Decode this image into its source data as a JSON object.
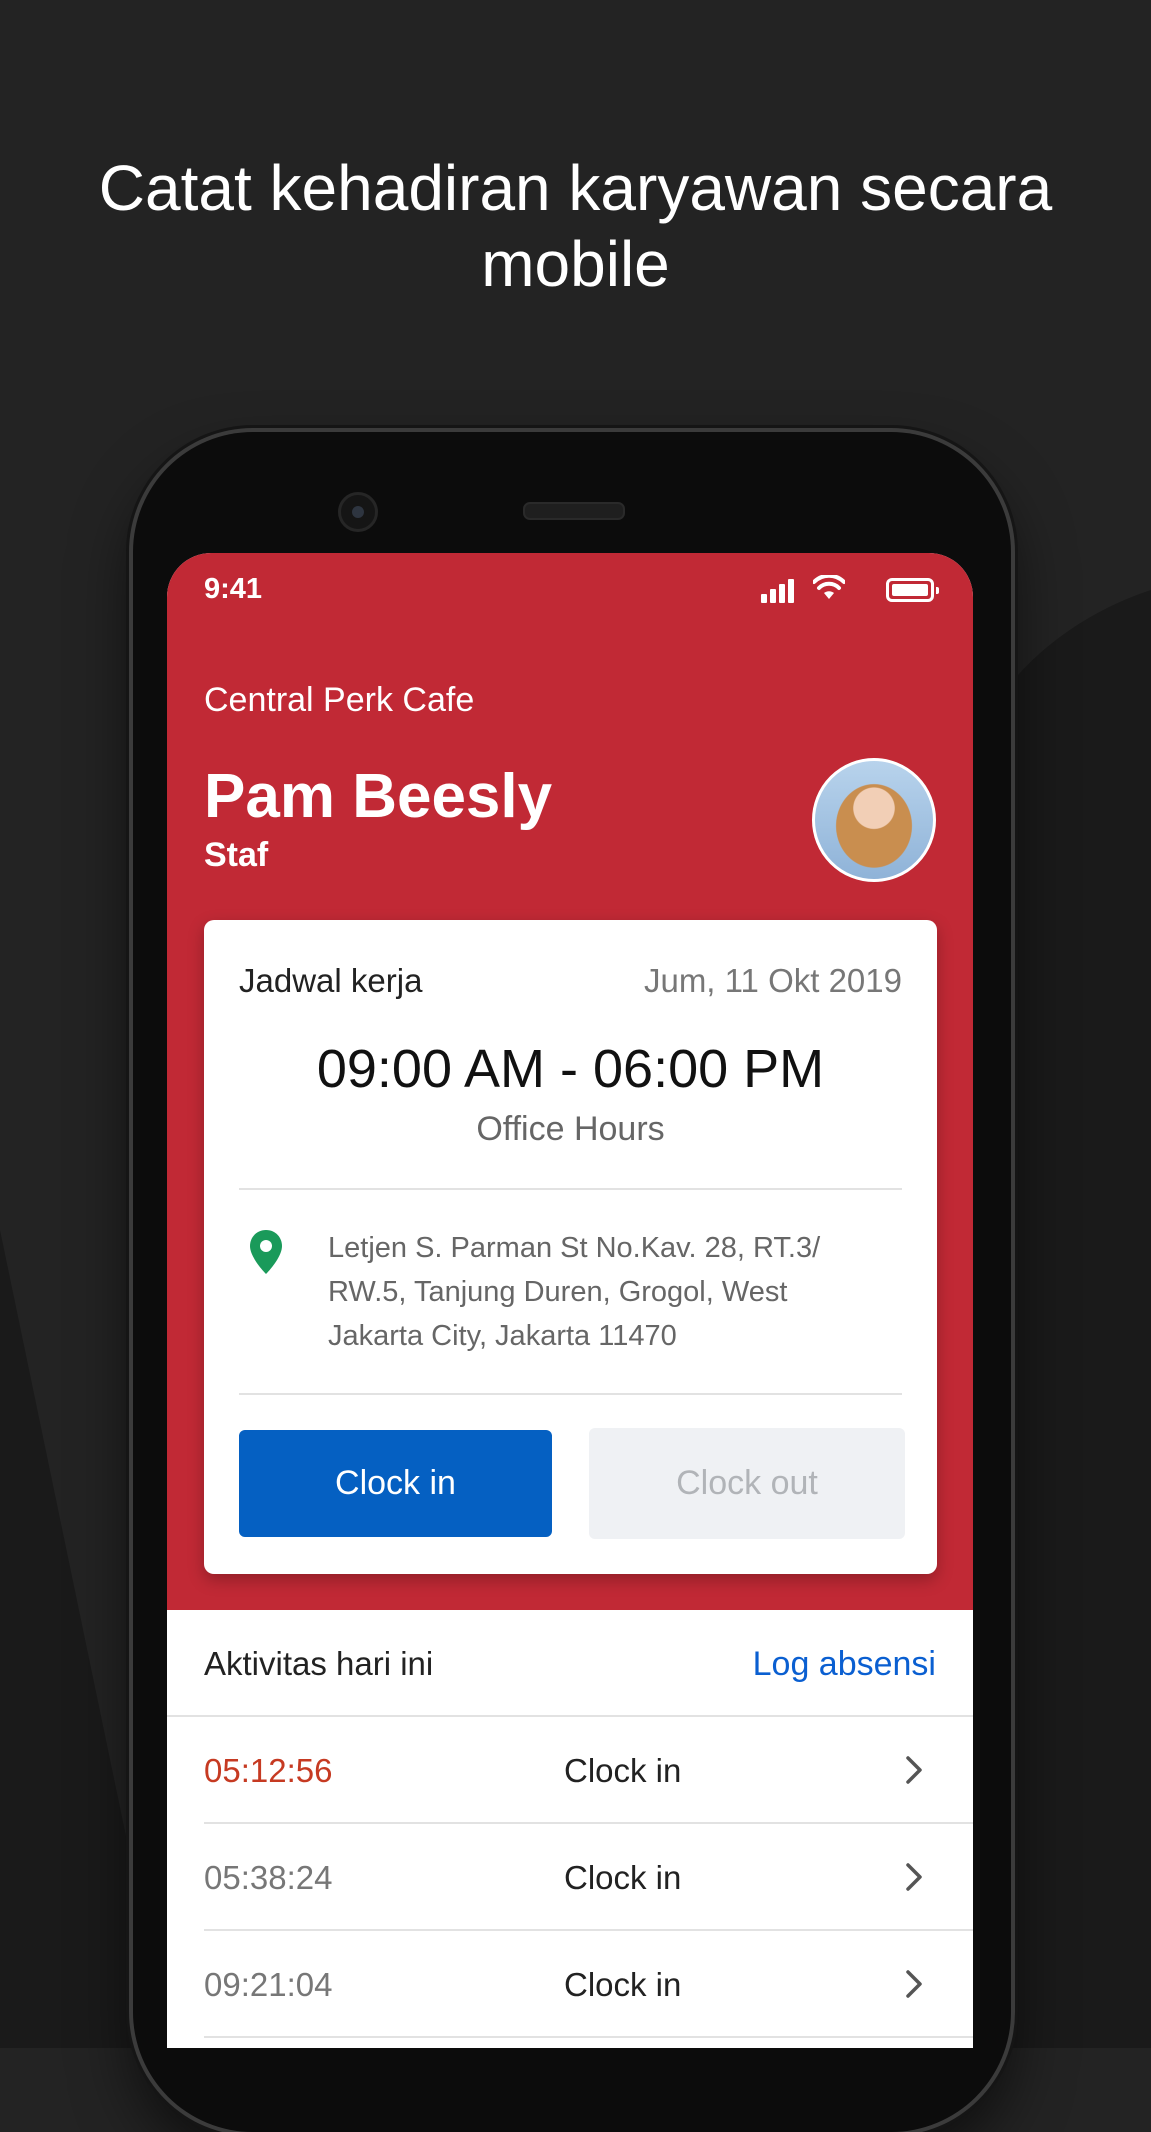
{
  "headline": {
    "line1": "Catat kehadiran karyawan secara",
    "line2": "mobile"
  },
  "status_bar": {
    "time": "9:41",
    "icons": [
      "signal-icon",
      "wifi-icon",
      "battery-icon"
    ]
  },
  "header": {
    "company": "Central Perk Cafe",
    "user_name": "Pam Beesly",
    "user_role": "Staf"
  },
  "schedule_card": {
    "title": "Jadwal kerja",
    "date": "Jum, 11 Okt 2019",
    "hours": "09:00 AM - 06:00 PM",
    "hours_label": "Office Hours",
    "address": "Letjen S. Parman St No.Kav. 28, RT.3/ RW.5, Tanjung Duren, Grogol, West Jakarta City, Jakarta 11470",
    "clock_in_label": "Clock in",
    "clock_out_label": "Clock out"
  },
  "activity": {
    "title": "Aktivitas hari ini",
    "link_label": "Log absensi",
    "rows": [
      {
        "time": "05:12:56",
        "type": "Clock in"
      },
      {
        "time": "05:38:24",
        "type": "Clock in"
      },
      {
        "time": "09:21:04",
        "type": "Clock in"
      }
    ]
  },
  "colors": {
    "header_bg": "#c12935",
    "primary_button": "#0560c2",
    "link": "#0a5fd1",
    "late_time": "#c63a22",
    "location_pin": "#1a9a5a"
  }
}
